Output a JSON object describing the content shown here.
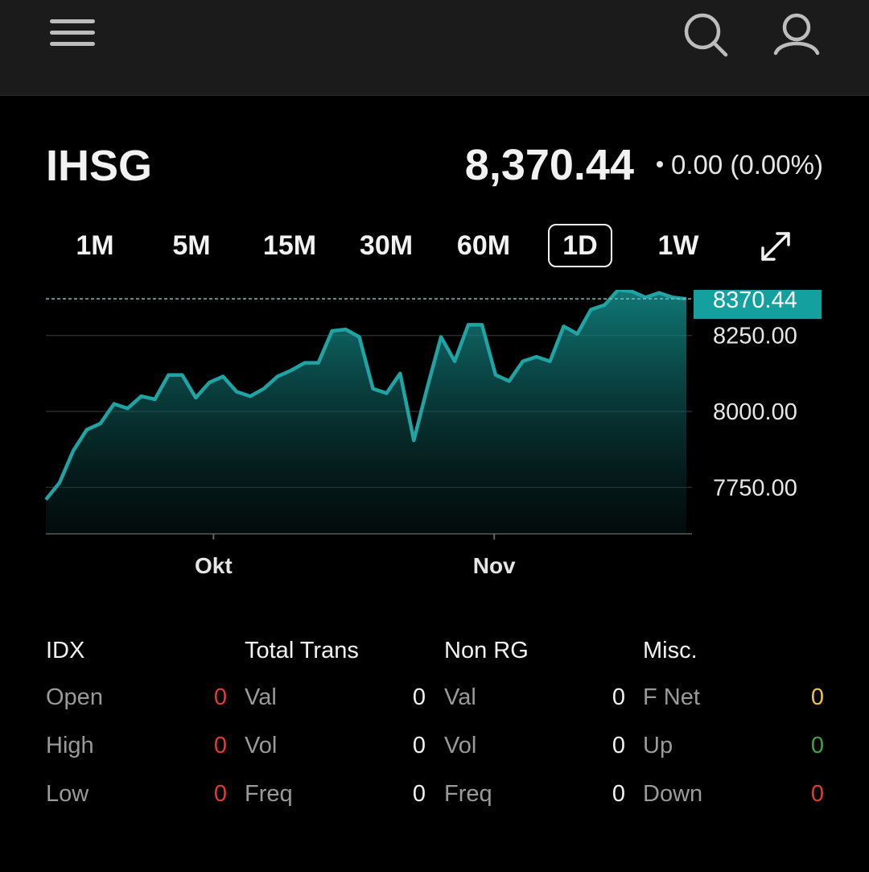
{
  "colors": {
    "background": "#000000",
    "topbar": "#1b1b1b",
    "accent": "#1fa3a3",
    "price_tag": "#14a09e",
    "red": "#e53935",
    "green": "#43a047",
    "yellow": "#f0c24a",
    "label_gray": "#9a9a9a"
  },
  "header": {
    "icons": [
      "menu-icon",
      "search-icon",
      "user-icon"
    ]
  },
  "quote": {
    "symbol": "IHSG",
    "price": "8,370.44",
    "change": "0.00 (0.00%)"
  },
  "timeframes": [
    {
      "label": "1M",
      "active": false
    },
    {
      "label": "5M",
      "active": false
    },
    {
      "label": "15M",
      "active": false
    },
    {
      "label": "30M",
      "active": false
    },
    {
      "label": "60M",
      "active": false
    },
    {
      "label": "1D",
      "active": true
    },
    {
      "label": "1W",
      "active": false
    }
  ],
  "chart_data": {
    "type": "area",
    "x_tick_labels": [
      "Okt",
      "Nov"
    ],
    "y_tick_labels": [
      "8250.00",
      "8000.00",
      "7750.00"
    ],
    "y_ticks": [
      8250,
      8000,
      7750
    ],
    "ylim": [
      7600,
      8400
    ],
    "last_price_label": "8370.44",
    "last_price": 8370.44,
    "grid": true,
    "series": [
      {
        "values": [
          7710,
          7765,
          7870,
          7940,
          7960,
          8025,
          8010,
          8050,
          8040,
          8120,
          8120,
          8045,
          8095,
          8115,
          8065,
          8050,
          8075,
          8115,
          8135,
          8160,
          8160,
          8265,
          8270,
          8245,
          8075,
          8060,
          8125,
          7905,
          8080,
          8245,
          8165,
          8285,
          8285,
          8120,
          8100,
          8165,
          8180,
          8165,
          8280,
          8255,
          8335,
          8350,
          8400,
          8395,
          8375,
          8390,
          8375,
          8370.44
        ]
      }
    ]
  },
  "stats": {
    "columns": [
      {
        "title": "IDX",
        "rows": [
          {
            "label": "Open",
            "value": "0",
            "color": "#e53935"
          },
          {
            "label": "High",
            "value": "0",
            "color": "#e53935"
          },
          {
            "label": "Low",
            "value": "0",
            "color": "#e53935"
          }
        ]
      },
      {
        "title": "Total Trans",
        "rows": [
          {
            "label": "Val",
            "value": "0",
            "color": "#f2f2f2"
          },
          {
            "label": "Vol",
            "value": "0",
            "color": "#f2f2f2"
          },
          {
            "label": "Freq",
            "value": "0",
            "color": "#f2f2f2"
          }
        ]
      },
      {
        "title": "Non RG",
        "rows": [
          {
            "label": "Val",
            "value": "0",
            "color": "#f2f2f2"
          },
          {
            "label": "Vol",
            "value": "0",
            "color": "#f2f2f2"
          },
          {
            "label": "Freq",
            "value": "0",
            "color": "#f2f2f2"
          }
        ]
      },
      {
        "title": "Misc.",
        "rows": [
          {
            "label": "F Net",
            "value": "0",
            "color": "#f0c24a"
          },
          {
            "label": "Up",
            "value": "0",
            "color": "#43a047"
          },
          {
            "label": "Down",
            "value": "0",
            "color": "#e53935"
          }
        ]
      }
    ]
  }
}
